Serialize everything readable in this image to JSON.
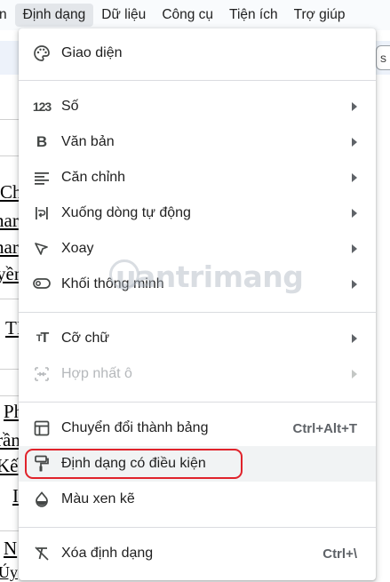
{
  "menubar": {
    "items": [
      "n",
      "Định dạng",
      "Dữ liệu",
      "Công cụ",
      "Tiện ích",
      "Trợ giúp"
    ],
    "active_index": 1
  },
  "toolbar": {
    "right_fragment": "s"
  },
  "background_fragments": [
    "Ch",
    "nar",
    "nar",
    "yền",
    "TI",
    "Ph",
    "rần",
    "Kế",
    "I",
    "N",
    "Úy"
  ],
  "menu": {
    "items": [
      {
        "label": "Giao diện",
        "icon": "palette-icon",
        "submenu": false
      },
      {
        "label": "Số",
        "icon": "numbers-123-icon",
        "submenu": true
      },
      {
        "label": "Văn bản",
        "icon": "bold-icon",
        "submenu": true
      },
      {
        "label": "Căn chỉnh",
        "icon": "align-left-icon",
        "submenu": true
      },
      {
        "label": "Xuống dòng tự động",
        "icon": "text-wrap-icon",
        "submenu": true
      },
      {
        "label": "Xoay",
        "icon": "text-rotation-icon",
        "submenu": true
      },
      {
        "label": "Khối thông minh",
        "icon": "smart-chip-icon",
        "submenu": true
      },
      {
        "label": "Cỡ chữ",
        "icon": "font-size-icon",
        "submenu": true
      },
      {
        "label": "Hợp nhất ô",
        "icon": "merge-cells-icon",
        "submenu": true,
        "disabled": true
      },
      {
        "label": "Chuyển đổi thành bảng",
        "icon": "convert-table-icon",
        "shortcut": "Ctrl+Alt+T"
      },
      {
        "label": "Định dạng có điều kiện",
        "icon": "paint-roller-icon",
        "highlighted": true
      },
      {
        "label": "Màu xen kẽ",
        "icon": "color-drop-icon"
      },
      {
        "label": "Xóa định dạng",
        "icon": "clear-format-icon",
        "shortcut": "Ctrl+\\"
      }
    ]
  },
  "watermark": "uantrimang",
  "colors": {
    "highlight_box": "#e0232b",
    "row_hover": "#f1f3f4",
    "menubar_active": "#e3e6ea"
  }
}
